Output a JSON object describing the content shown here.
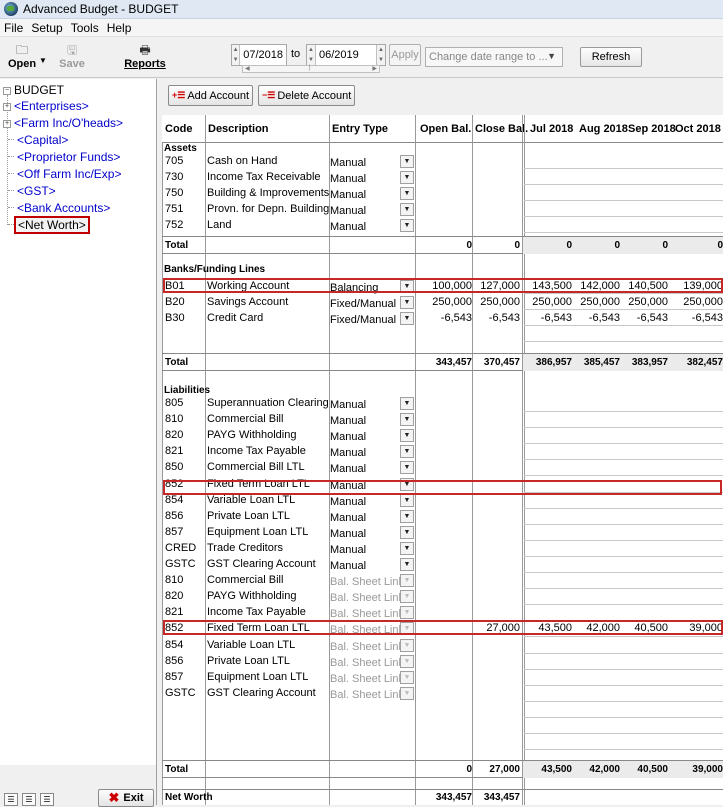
{
  "window": {
    "title": "Advanced Budget - BUDGET"
  },
  "menu": [
    "File",
    "Setup",
    "Tools",
    "Help"
  ],
  "toolbar": {
    "open_label": "Open",
    "save_label": "Save",
    "reports_label": "Reports",
    "date_from": "07/2018",
    "to_label": "to",
    "date_to": "06/2019",
    "apply_label": "Apply",
    "date_range_placeholder": "Change date range to ...",
    "refresh_label": "Refresh"
  },
  "tree": {
    "root": "BUDGET",
    "items": [
      "<Enterprises>",
      "<Farm Inc/O'heads>",
      "<Capital>",
      "<Proprietor Funds>",
      "<Off Farm Inc/Exp>",
      "<GST>",
      "<Bank Accounts>",
      "<Net Worth>"
    ]
  },
  "buttons": {
    "add_account": "Add Account",
    "delete_account": "Delete Account",
    "exit": "Exit"
  },
  "columns": {
    "code": "Code",
    "description": "Description",
    "entry_type": "Entry Type",
    "open_bal": "Open Bal.",
    "close_bal": "Close Bal.",
    "m1": "Jul 2018",
    "m2": "Aug 2018",
    "m3": "Sep 2018",
    "m4": "Oct 2018"
  },
  "assets": {
    "title": "Assets",
    "rows": [
      {
        "code": "705",
        "desc": "Cash on Hand",
        "entry": "Manual"
      },
      {
        "code": "730",
        "desc": "Income Tax Receivable",
        "entry": "Manual"
      },
      {
        "code": "750",
        "desc": "Building & Improvements",
        "entry": "Manual"
      },
      {
        "code": "751",
        "desc": "Provn. for Depn. Building",
        "entry": "Manual"
      },
      {
        "code": "752",
        "desc": "Land",
        "entry": "Manual"
      }
    ],
    "total": {
      "label": "Total",
      "open": "0",
      "close": "0",
      "m1": "0",
      "m2": "0",
      "m3": "0",
      "m4": "0"
    }
  },
  "banks": {
    "title": "Banks/Funding Lines",
    "rows": [
      {
        "code": "B01",
        "desc": "Working Account",
        "entry": "Balancing",
        "open": "100,000",
        "close": "127,000",
        "m1": "143,500",
        "m2": "142,000",
        "m3": "140,500",
        "m4": "139,000"
      },
      {
        "code": "B20",
        "desc": "Savings Account",
        "entry": "Fixed/Manual",
        "open": "250,000",
        "close": "250,000",
        "m1": "250,000",
        "m2": "250,000",
        "m3": "250,000",
        "m4": "250,000"
      },
      {
        "code": "B30",
        "desc": "Credit Card",
        "entry": "Fixed/Manual",
        "open": "-6,543",
        "close": "-6,543",
        "m1": "-6,543",
        "m2": "-6,543",
        "m3": "-6,543",
        "m4": "-6,543"
      }
    ],
    "total": {
      "label": "Total",
      "open": "343,457",
      "close": "370,457",
      "m1": "386,957",
      "m2": "385,457",
      "m3": "383,957",
      "m4": "382,457"
    }
  },
  "liabilities": {
    "title": "Liabilities",
    "rows": [
      {
        "code": "805",
        "desc": "Superannuation Clearing",
        "entry": "Manual"
      },
      {
        "code": "810",
        "desc": "Commercial Bill",
        "entry": "Manual"
      },
      {
        "code": "820",
        "desc": "PAYG Withholding",
        "entry": "Manual"
      },
      {
        "code": "821",
        "desc": "Income Tax Payable",
        "entry": "Manual"
      },
      {
        "code": "850",
        "desc": "Commercial Bill LTL",
        "entry": "Manual"
      },
      {
        "code": "852",
        "desc": "Fixed Term Loan LTL",
        "entry": "Manual"
      },
      {
        "code": "854",
        "desc": "Variable Loan LTL",
        "entry": "Manual"
      },
      {
        "code": "856",
        "desc": "Private Loan LTL",
        "entry": "Manual"
      },
      {
        "code": "857",
        "desc": "Equipment Loan LTL",
        "entry": "Manual"
      },
      {
        "code": "CRED",
        "desc": "Trade Creditors",
        "entry": "Manual"
      },
      {
        "code": "GSTC",
        "desc": "GST Clearing Account",
        "entry": "Manual"
      },
      {
        "code": "810",
        "desc": "Commercial Bill",
        "entry": "Bal. Sheet Link"
      },
      {
        "code": "820",
        "desc": "PAYG Withholding",
        "entry": "Bal. Sheet Link"
      },
      {
        "code": "821",
        "desc": "Income Tax Payable",
        "entry": "Bal. Sheet Link"
      },
      {
        "code": "852",
        "desc": "Fixed Term Loan LTL",
        "entry": "Bal. Sheet Link",
        "close": "27,000",
        "m1": "43,500",
        "m2": "42,000",
        "m3": "40,500",
        "m4": "39,000"
      },
      {
        "code": "854",
        "desc": "Variable Loan LTL",
        "entry": "Bal. Sheet Link"
      },
      {
        "code": "856",
        "desc": "Private Loan LTL",
        "entry": "Bal. Sheet Link"
      },
      {
        "code": "857",
        "desc": "Equipment Loan LTL",
        "entry": "Bal. Sheet Link"
      },
      {
        "code": "GSTC",
        "desc": "GST Clearing Account",
        "entry": "Bal. Sheet Link"
      }
    ],
    "total": {
      "label": "Total",
      "open": "0",
      "close": "27,000",
      "m1": "43,500",
      "m2": "42,000",
      "m3": "40,500",
      "m4": "39,000"
    }
  },
  "net_worth": {
    "label": "Net Worth",
    "open": "343,457",
    "close": "343,457"
  },
  "colors": {
    "highlight": "#c62828",
    "link": "#0000cc"
  }
}
